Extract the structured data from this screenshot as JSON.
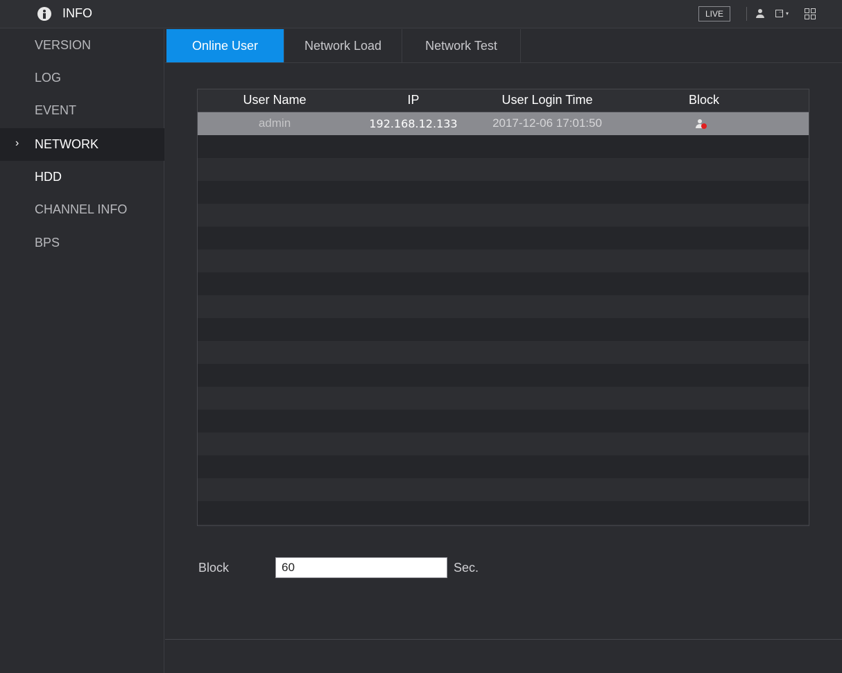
{
  "header": {
    "title": "INFO",
    "live_label": "LIVE",
    "icons": [
      "info-icon",
      "user-icon",
      "logout-icon",
      "qr-code-icon"
    ]
  },
  "sidebar": {
    "items": [
      {
        "label": "VERSION"
      },
      {
        "label": "LOG"
      },
      {
        "label": "EVENT"
      },
      {
        "label": "NETWORK",
        "active": true
      },
      {
        "label": "HDD"
      },
      {
        "label": "CHANNEL INFO"
      },
      {
        "label": "BPS"
      }
    ]
  },
  "tabs": [
    {
      "label": "Online User",
      "active": true
    },
    {
      "label": "Network Load"
    },
    {
      "label": "Network Test"
    }
  ],
  "table": {
    "columns": [
      "User Name",
      "IP",
      "User Login Time",
      "Block"
    ],
    "rows": [
      {
        "user": "admin",
        "ip": "192.168.12.133",
        "login_time": "2017-12-06 17:01:50",
        "block_icon": "block-user-icon"
      }
    ]
  },
  "block": {
    "label": "Block",
    "value": "60",
    "unit": "Sec."
  },
  "colors": {
    "accent": "#0d8ee8",
    "background": "#2b2c30",
    "selected_row": "#8a8b90"
  }
}
